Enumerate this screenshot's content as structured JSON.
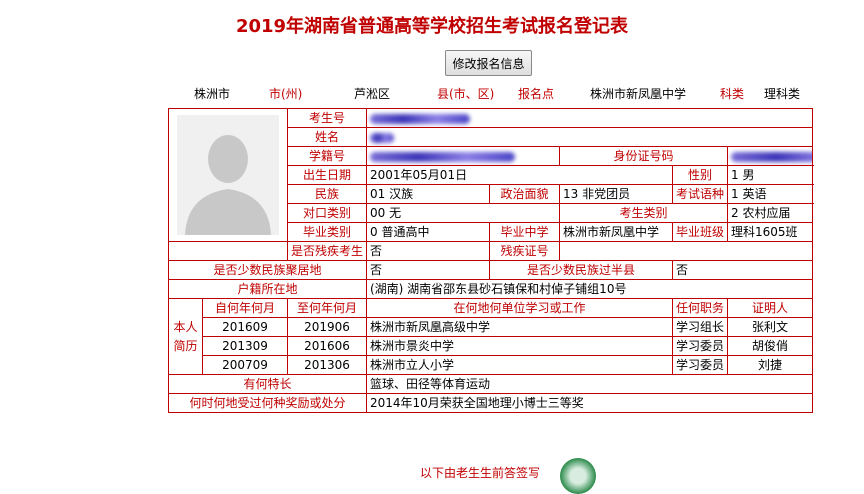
{
  "page": {
    "title": "2019年湖南省普通高等学校招生考试报名登记表",
    "edit_button": "修改报名信息"
  },
  "infobar": {
    "city": "株洲市",
    "city_label": "市(州)",
    "county": "芦淞区",
    "county_label": "县(市、区)",
    "site_label": "报名点",
    "site": "株洲市新凤凰中学",
    "subject_label": "科类",
    "subject": "理科类"
  },
  "labels": {
    "exam_no": "考生号",
    "name": "姓名",
    "school_no": "学籍号",
    "id_no": "身份证号码",
    "birth": "出生日期",
    "gender": "性别",
    "ethnicity": "民族",
    "politics": "政治面貌",
    "exam_lang": "考试语种",
    "counterpart": "对口类别",
    "examinee_type": "考生类别",
    "grad_type": "毕业类别",
    "grad_school": "毕业中学",
    "grad_class": "毕业班级",
    "disabled": "是否残疾考生",
    "disability_no": "残疾证号",
    "minority_area": "是否少数民族聚居地",
    "minority_half": "是否少数民族过半县",
    "household": "户籍所在地",
    "resume_vertical": "本人简历",
    "from": "自何年何月",
    "to": "至何年何月",
    "place": "在何地何单位学习或工作",
    "role": "任何职务",
    "witness": "证明人",
    "specialty": "有何特长",
    "awards": "何时何地受过何种奖励或处分"
  },
  "values": {
    "birth": "2001年05月01日",
    "gender": "1 男",
    "ethnicity": "01 汉族",
    "politics": "13 非党团员",
    "exam_lang": "1 英语",
    "counterpart": "00 无",
    "examinee_type": "2 农村应届",
    "grad_type": "0 普通高中",
    "grad_school": "株洲市新凤凰中学",
    "grad_class": "理科1605班",
    "disabled": "否",
    "disability_no": "",
    "minority_area": "否",
    "minority_half": "否",
    "household": "(湖南) 湖南省邵东县砂石镇保和村倬子铺组10号",
    "specialty": "篮球、田径等体育运动",
    "awards": "2014年10月荣获全国地理小博士三等奖"
  },
  "resume": [
    {
      "from": "201609",
      "to": "201906",
      "place": "株洲市新凤凰高级中学",
      "role": "学习组长",
      "witness": "张利文"
    },
    {
      "from": "201309",
      "to": "201606",
      "place": "株洲市景炎中学",
      "role": "学习委员",
      "witness": "胡俊俏"
    },
    {
      "from": "200709",
      "to": "201306",
      "place": "株洲市立人小学",
      "role": "学习委员",
      "witness": "刘捷"
    }
  ],
  "bottom": {
    "partial_text": "以下由老生生前答签写"
  },
  "colors": {
    "accent": "#c00000"
  }
}
